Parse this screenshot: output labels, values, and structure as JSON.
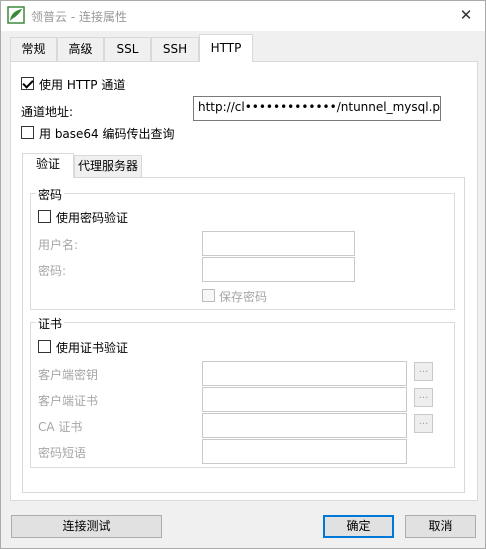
{
  "window": {
    "title": "领普云 - 连接属性",
    "close_symbol": "✕"
  },
  "tabs": [
    {
      "label": "常规",
      "active": false
    },
    {
      "label": "高级",
      "active": false
    },
    {
      "label": "SSL",
      "active": false
    },
    {
      "label": "SSH",
      "active": false
    },
    {
      "label": "HTTP",
      "active": true
    }
  ],
  "http": {
    "use_tunnel": {
      "label": "使用 HTTP 通道",
      "checked": true
    },
    "tunnel_url": {
      "label": "通道地址:",
      "value": "http://cl•••••••••••••/ntunnel_mysql.p"
    },
    "base64": {
      "label": "用 base64 编码传出查询",
      "checked": false
    }
  },
  "inner_tabs": [
    {
      "label": "验证",
      "active": true
    },
    {
      "label": "代理服务器",
      "active": false
    }
  ],
  "password_group": {
    "title": "密码",
    "use_password": {
      "label": "使用密码验证",
      "checked": false
    },
    "username_label": "用户名:",
    "username_value": "",
    "password_label": "密码:",
    "password_value": "",
    "save_password": {
      "label": "保存密码",
      "checked": false
    }
  },
  "cert_group": {
    "title": "证书",
    "use_cert": {
      "label": "使用证书验证",
      "checked": false
    },
    "client_key_label": "客户端密钥",
    "client_cert_label": "客户端证书",
    "ca_cert_label": "CA 证书",
    "passphrase_label": "密码短语",
    "browse_label": "..."
  },
  "buttons": {
    "test": "连接测试",
    "ok": "确定",
    "cancel": "取消"
  },
  "colors": {
    "accent": "#0078d7",
    "logo_green": "#3a8a3a"
  }
}
